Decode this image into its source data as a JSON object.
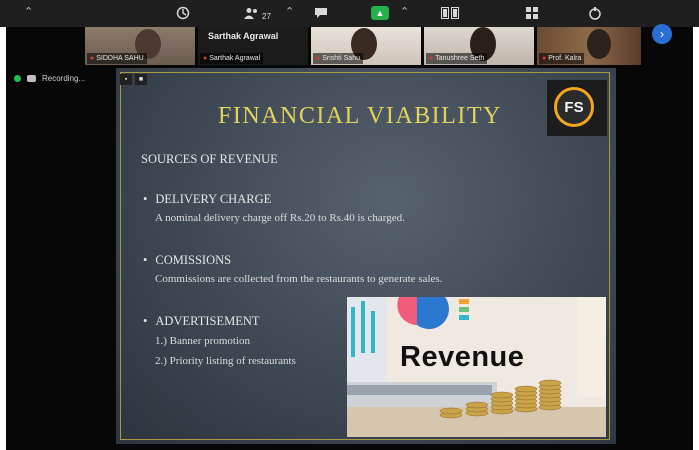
{
  "toolbar": {
    "icons": [
      "chevron-up-icon",
      "security-icon",
      "participants-icon",
      "chat-icon",
      "share-screen-icon",
      "breakout-rooms-icon",
      "apps-icon",
      "whiteboard-icon"
    ],
    "participant_count": "27"
  },
  "participants": [
    {
      "name": "SIDDHA SAHU",
      "video": true
    },
    {
      "name": "Sarthak Agrawal",
      "video": false
    },
    {
      "name": "Srishti Sahu",
      "video": true
    },
    {
      "name": "Tanushree Seth",
      "video": true
    },
    {
      "name": "Prof. Kalra",
      "video": true
    }
  ],
  "recording": {
    "label": "Recording..."
  },
  "slide": {
    "title": "FINANCIAL VIABILITY",
    "logo": "FS",
    "sources_heading": "SOURCES OF REVENUE",
    "bullet1": "DELIVERY CHARGE",
    "bullet1_text": "A nominal delivery charge off Rs.20 to Rs.40 is charged.",
    "bullet2": "COMISSIONS",
    "bullet2_text": "Commissions are collected from the restaurants to generate sales.",
    "bullet3": "ADVERTISEMENT",
    "bullet3_item1": "1.) Banner promotion",
    "bullet3_item2": "2.) Priority listing of restaurants",
    "image_text": "Revenue"
  },
  "colors": {
    "title": "#e2d25a",
    "logo_ring": "#f2a51e",
    "frame": "#a89a43",
    "green": "#24b14c",
    "blue": "#2b6fd6"
  }
}
